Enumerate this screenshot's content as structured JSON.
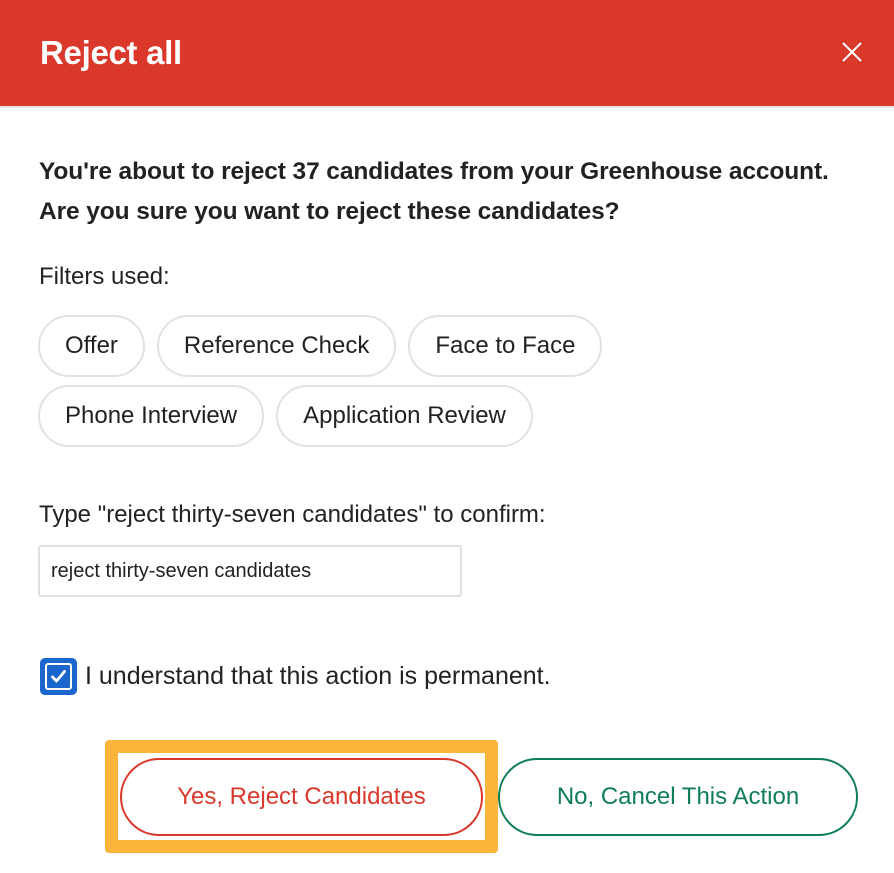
{
  "dialog": {
    "title": "Reject all",
    "close_icon": "close-icon",
    "message": "You're about to reject 37 candidates from your Greenhouse account. Are you sure you want to reject these candidates?",
    "filters": {
      "label": "Filters used:",
      "rows": [
        [
          "Offer",
          "Reference Check",
          "Face to Face"
        ],
        [
          "Phone Interview",
          "Application Review"
        ]
      ]
    },
    "confirm": {
      "label": "Type \"reject thirty-seven candidates\" to confirm:",
      "value": "reject thirty-seven candidates",
      "placeholder": ""
    },
    "acknowledge": {
      "checked": true,
      "label": "I understand that this action is permanent.",
      "icon": "checkmark-icon"
    },
    "buttons": {
      "reject_label": "Yes, Reject Candidates",
      "cancel_label": "No, Cancel This Action"
    }
  },
  "colors": {
    "header_bg": "#d9382b",
    "reject": "#d9382b",
    "cancel": "#0f7e55",
    "checkbox": "#1a66cc",
    "highlight": "#fcb53b"
  }
}
